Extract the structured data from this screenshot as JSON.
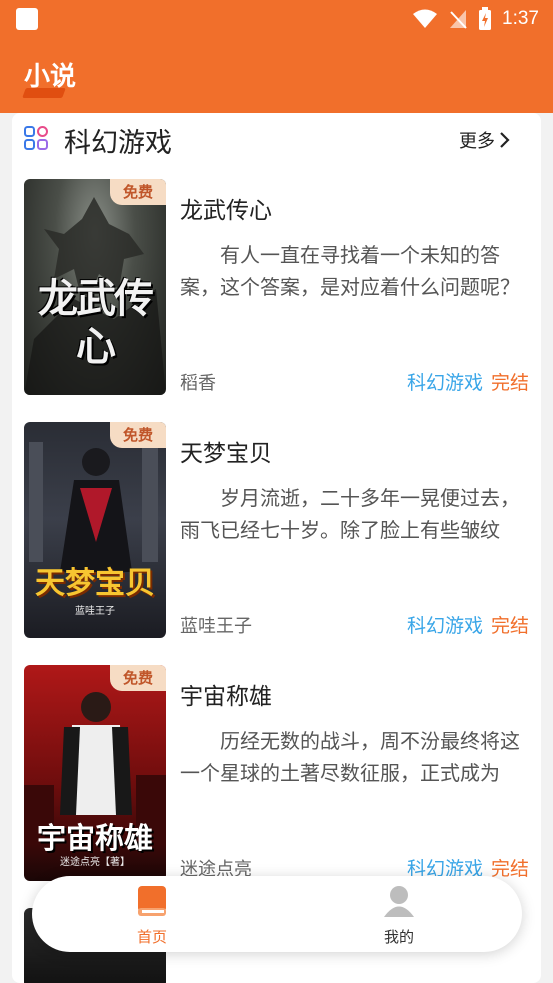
{
  "status_bar": {
    "time": "1:37"
  },
  "app": {
    "title": "小说"
  },
  "section": {
    "title": "科幻游戏",
    "more_label": "更多"
  },
  "books": [
    {
      "title": "龙武传心",
      "description": "有人一直在寻找着一个未知的答案，这个答案，是对应着什么问题呢？",
      "author": "稻香",
      "category": "科幻游戏",
      "status": "完结",
      "badge": "免费",
      "cover_text": "龙武传心"
    },
    {
      "title": "天梦宝贝",
      "description": "岁月流逝，二十多年一晃便过去，雨飞已经七十岁。除了脸上有些皱纹",
      "author": "蓝哇王子",
      "category": "科幻游戏",
      "status": "完结",
      "badge": "免费",
      "cover_text": "天梦宝贝",
      "cover_subtext": "蓝哇王子"
    },
    {
      "title": "宇宙称雄",
      "description": "历经无数的战斗，周不汾最终将这一个星球的土著尽数征服，正式成为",
      "author": "迷途点亮",
      "category": "科幻游戏",
      "status": "完结",
      "badge": "免费",
      "cover_text": "宇宙称雄",
      "cover_subtext": "迷途点亮【著】"
    }
  ],
  "bottom_nav": {
    "items": [
      {
        "label": "首页",
        "icon": "book-icon",
        "active": true
      },
      {
        "label": "我的",
        "icon": "person-icon",
        "active": false
      }
    ]
  },
  "colors": {
    "accent": "#f16f2b",
    "category": "#3aa6e8",
    "badge_bg": "#f6dcc4"
  }
}
